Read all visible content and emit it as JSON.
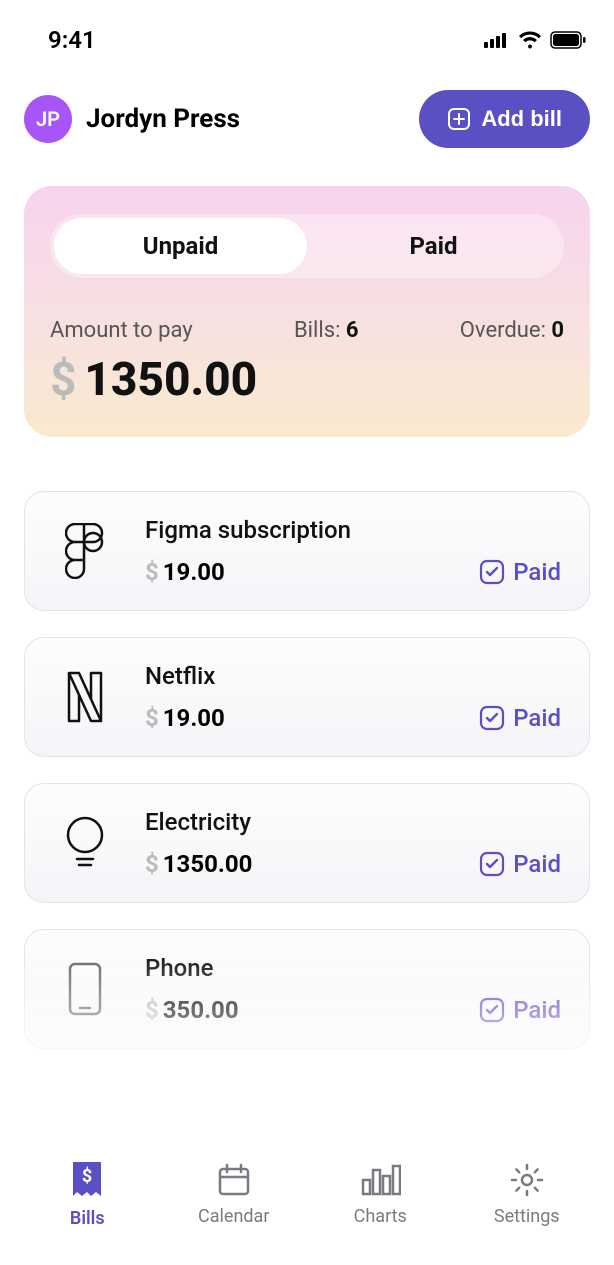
{
  "status": {
    "time": "9:41"
  },
  "user": {
    "initials": "JP",
    "name": "Jordyn Press"
  },
  "header": {
    "addBillLabel": "Add bill"
  },
  "segmented": {
    "unpaid": "Unpaid",
    "paid": "Paid"
  },
  "summary": {
    "amountLabel": "Amount to pay",
    "amountCurrency": "$",
    "amount": "1350.00",
    "billsLabel": "Bills:",
    "billsCount": "6",
    "overdueLabel": "Overdue:",
    "overdueCount": "0"
  },
  "bills": [
    {
      "icon": "figma",
      "title": "Figma subscription",
      "currency": "$",
      "amount": "19.00",
      "status": "Paid"
    },
    {
      "icon": "netflix",
      "title": "Netflix",
      "currency": "$",
      "amount": "19.00",
      "status": "Paid"
    },
    {
      "icon": "bulb",
      "title": "Electricity",
      "currency": "$",
      "amount": "1350.00",
      "status": "Paid"
    },
    {
      "icon": "phone",
      "title": "Phone",
      "currency": "$",
      "amount": "350.00",
      "status": "Paid"
    }
  ],
  "tabs": {
    "bills": "Bills",
    "calendar": "Calendar",
    "charts": "Charts",
    "settings": "Settings"
  },
  "colors": {
    "accent": "#5b4fc4",
    "avatar": "#a855f7"
  }
}
